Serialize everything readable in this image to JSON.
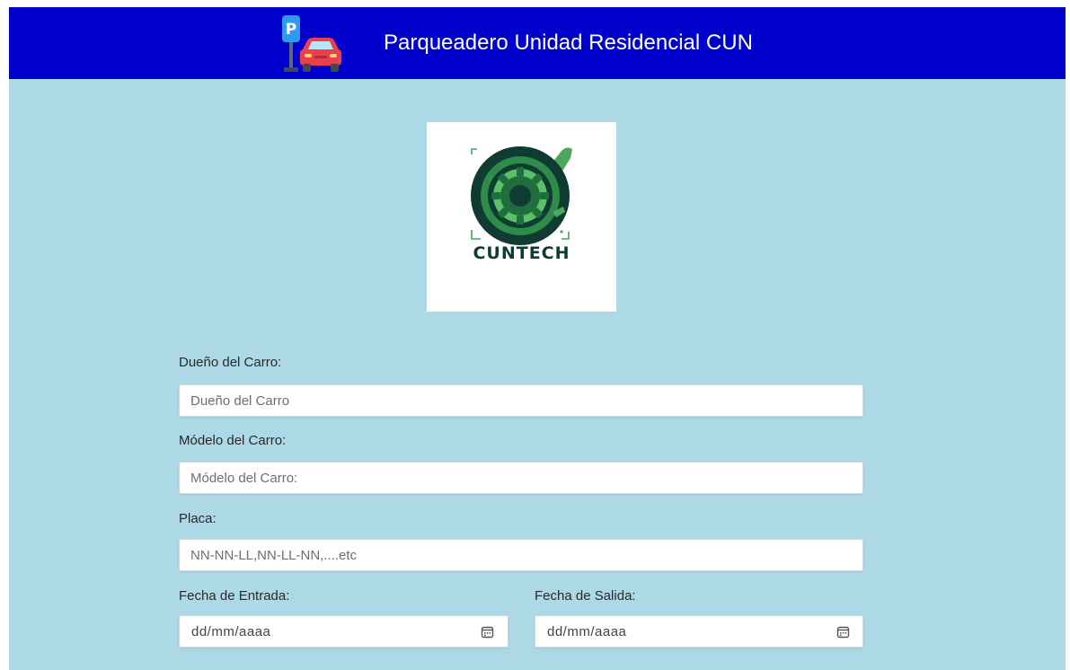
{
  "header": {
    "title": "Parqueadero Unidad Residencial CUN",
    "logo_icon": "parking-car-icon",
    "logo_letter": "P",
    "bg_color": "#0000cc"
  },
  "brand": {
    "icon": "gear-key-icon",
    "text": "CUNTECH"
  },
  "form": {
    "owner": {
      "label": "Dueño del Carro:",
      "placeholder": "Dueño del Carro"
    },
    "model": {
      "label": "Módelo del Carro:",
      "placeholder": "Módelo del Carro:"
    },
    "plate": {
      "label": "Placa:",
      "placeholder": "NN-NN-LL,NN-LL-NN,....etc"
    },
    "entry_date": {
      "label": "Fecha de Entrada:",
      "value_text": "dd/mm/aaaa",
      "icon": "calendar-icon"
    },
    "exit_date": {
      "label": "Fecha de Salida:",
      "value_text": "dd/mm/aaaa",
      "icon": "calendar-icon"
    }
  },
  "colors": {
    "page_bg": "#add8e6",
    "header_bg": "#0000cc",
    "accent_green": "#3aa757"
  }
}
